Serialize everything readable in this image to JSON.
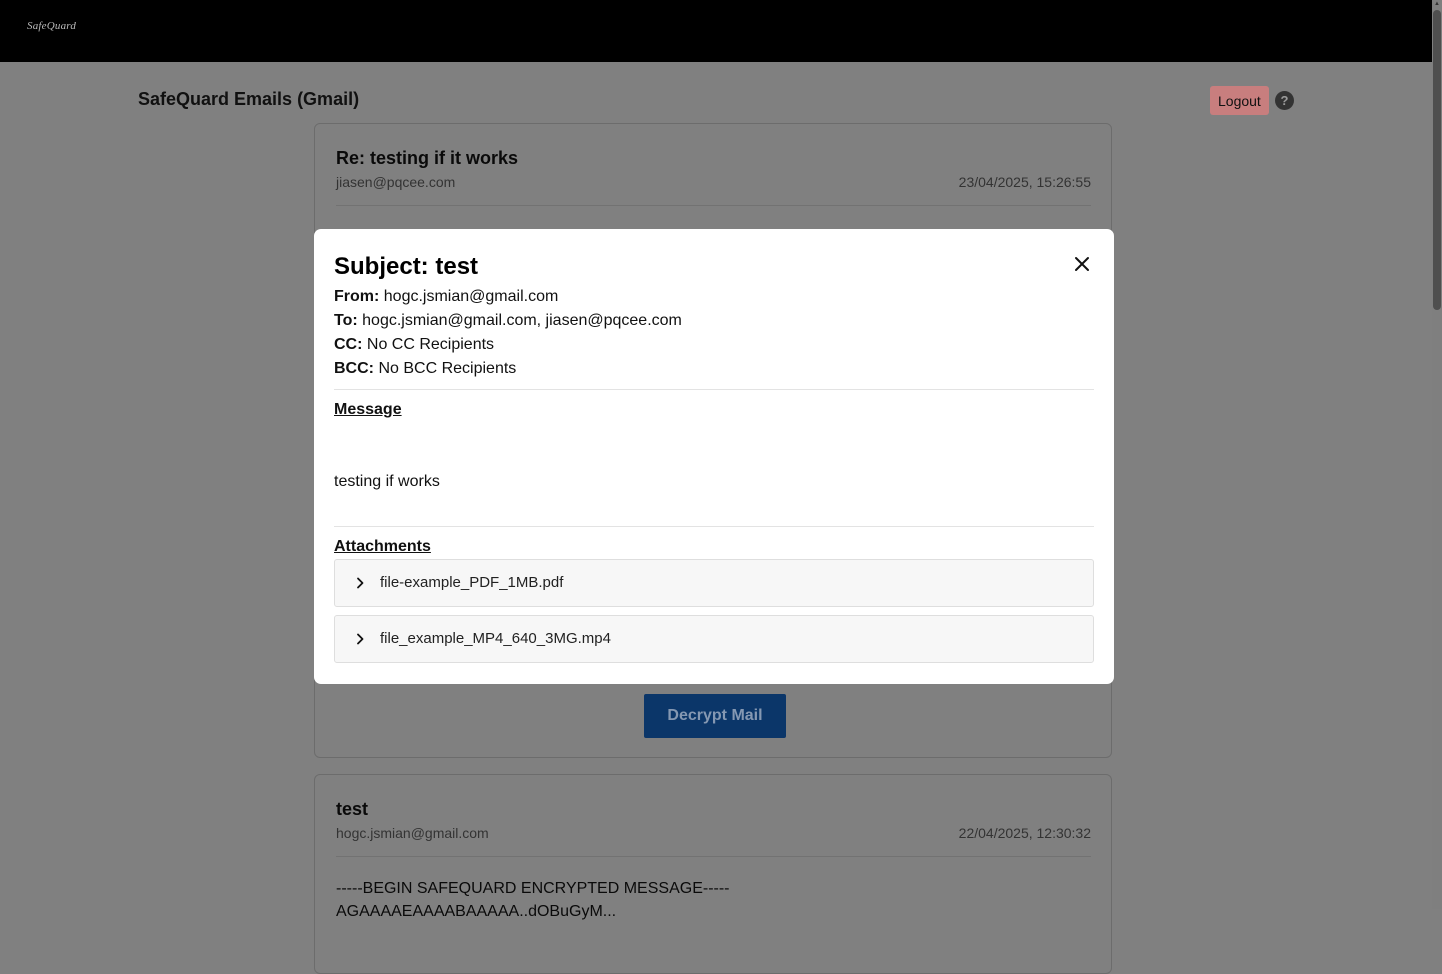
{
  "header": {
    "logo_text": "SafeQuard"
  },
  "page": {
    "title": "SafeQuard Emails (Gmail)",
    "logout_label": "Logout",
    "help_label": "?"
  },
  "emails": [
    {
      "subject": "Re: testing if it works",
      "from": "jiasen@pqcee.com",
      "date": "23/04/2025, 15:26:55",
      "decrypt_label": "Decrypt Mail"
    },
    {
      "subject": "test",
      "from": "hogc.jsmian@gmail.com",
      "date": "22/04/2025, 12:30:32",
      "body_line1": "-----BEGIN SAFEQUARD ENCRYPTED MESSAGE-----",
      "body_line2": "AGAAAAEAAAABAAAAA..dOBuGyM..."
    }
  ],
  "modal": {
    "subject_label": "Subject:",
    "subject": "test",
    "from_label": "From:",
    "from": "hogc.jsmian@gmail.com",
    "to_label": "To:",
    "to": "hogc.jsmian@gmail.com, jiasen@pqcee.com",
    "cc_label": "CC:",
    "cc": "No CC Recipients",
    "bcc_label": "BCC:",
    "bcc": "No BCC Recipients",
    "message_heading": "Message",
    "message": "testing if works",
    "attachments_heading": "Attachments",
    "attachments": [
      {
        "name": "file-example_PDF_1MB.pdf"
      },
      {
        "name": "file_example_MP4_640_3MG.mp4"
      }
    ]
  },
  "icons": {
    "close": "close-icon",
    "chevron": "chevron-right-icon",
    "help": "help-icon"
  },
  "colors": {
    "overlay": "#808080",
    "topbar": "#000000",
    "logout_bg": "#c87e7e",
    "decrypt_bg": "#0b3669"
  }
}
